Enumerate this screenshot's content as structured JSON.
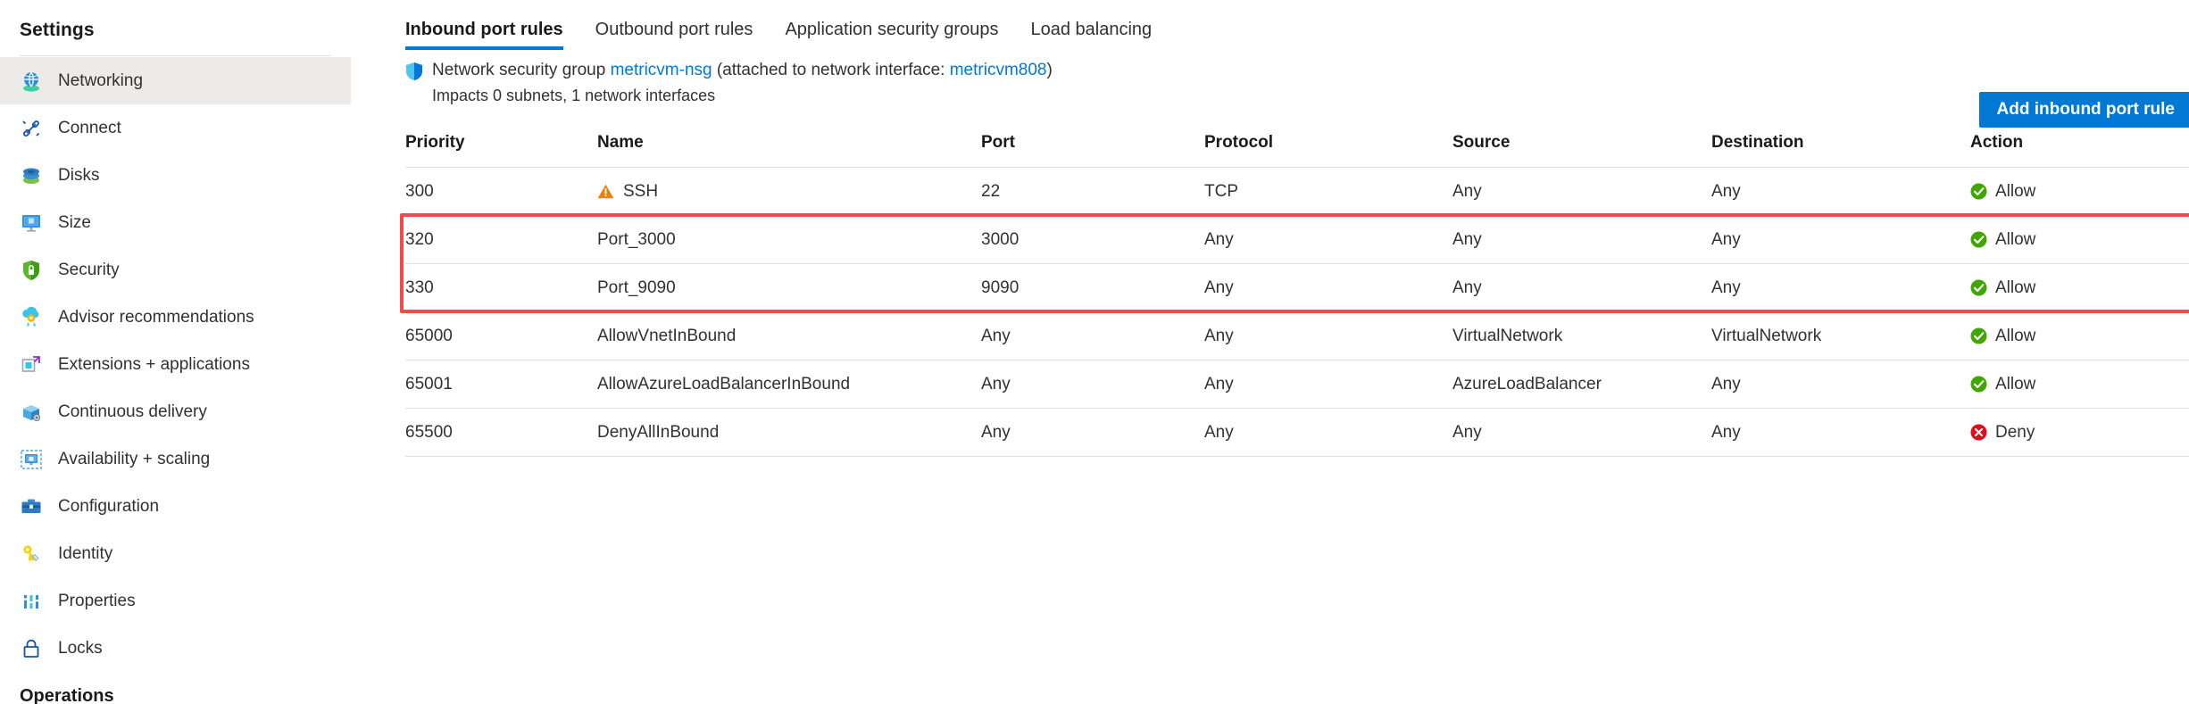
{
  "sidebar": {
    "title": "Settings",
    "group_title": "Operations",
    "items": [
      {
        "label": "Networking",
        "icon": "networking-icon",
        "selected": true
      },
      {
        "label": "Connect",
        "icon": "connect-icon",
        "selected": false
      },
      {
        "label": "Disks",
        "icon": "disks-icon",
        "selected": false
      },
      {
        "label": "Size",
        "icon": "size-icon",
        "selected": false
      },
      {
        "label": "Security",
        "icon": "security-shield-icon",
        "selected": false
      },
      {
        "label": "Advisor recommendations",
        "icon": "advisor-icon",
        "selected": false
      },
      {
        "label": "Extensions + applications",
        "icon": "extensions-icon",
        "selected": false
      },
      {
        "label": "Continuous delivery",
        "icon": "continuous-delivery-icon",
        "selected": false
      },
      {
        "label": "Availability + scaling",
        "icon": "availability-scaling-icon",
        "selected": false
      },
      {
        "label": "Configuration",
        "icon": "configuration-icon",
        "selected": false
      },
      {
        "label": "Identity",
        "icon": "identity-key-icon",
        "selected": false
      },
      {
        "label": "Properties",
        "icon": "properties-icon",
        "selected": false
      },
      {
        "label": "Locks",
        "icon": "lock-icon",
        "selected": false
      }
    ]
  },
  "tabs": [
    {
      "label": "Inbound port rules",
      "active": true
    },
    {
      "label": "Outbound port rules",
      "active": false
    },
    {
      "label": "Application security groups",
      "active": false
    },
    {
      "label": "Load balancing",
      "active": false
    }
  ],
  "nsg": {
    "prefix": "Network security group ",
    "name": "metricvm-nsg",
    "attach_prefix": " (attached to network interface: ",
    "interface": "metricvm808",
    "attach_suffix": ")",
    "impacts": "Impacts 0 subnets, 1 network interfaces",
    "icon": "shield-icon"
  },
  "toolbar": {
    "add_rule_label": "Add inbound port rule"
  },
  "table": {
    "columns": [
      "Priority",
      "Name",
      "Port",
      "Protocol",
      "Source",
      "Destination",
      "Action"
    ],
    "rows": [
      {
        "priority": "300",
        "name": "SSH",
        "name_icon": "warning-icon",
        "port": "22",
        "protocol": "TCP",
        "source": "Any",
        "destination": "Any",
        "action": "Allow",
        "action_icon": "allow-check-icon",
        "highlighted": false
      },
      {
        "priority": "320",
        "name": "Port_3000",
        "name_icon": null,
        "port": "3000",
        "protocol": "Any",
        "source": "Any",
        "destination": "Any",
        "action": "Allow",
        "action_icon": "allow-check-icon",
        "highlighted": true
      },
      {
        "priority": "330",
        "name": "Port_9090",
        "name_icon": null,
        "port": "9090",
        "protocol": "Any",
        "source": "Any",
        "destination": "Any",
        "action": "Allow",
        "action_icon": "allow-check-icon",
        "highlighted": true
      },
      {
        "priority": "65000",
        "name": "AllowVnetInBound",
        "name_icon": null,
        "port": "Any",
        "protocol": "Any",
        "source": "VirtualNetwork",
        "destination": "VirtualNetwork",
        "action": "Allow",
        "action_icon": "allow-check-icon",
        "highlighted": false
      },
      {
        "priority": "65001",
        "name": "AllowAzureLoadBalancerInBound",
        "name_icon": null,
        "port": "Any",
        "protocol": "Any",
        "source": "AzureLoadBalancer",
        "destination": "Any",
        "action": "Allow",
        "action_icon": "allow-check-icon",
        "highlighted": false
      },
      {
        "priority": "65500",
        "name": "DenyAllInBound",
        "name_icon": null,
        "port": "Any",
        "protocol": "Any",
        "source": "Any",
        "destination": "Any",
        "action": "Deny",
        "action_icon": "deny-cross-icon",
        "highlighted": false
      }
    ]
  },
  "colors": {
    "accent_blue": "#0078d4",
    "link_blue": "#0078d4",
    "allow_green": "#3fa700",
    "deny_red": "#e00b1c",
    "warning_orange": "#e8820c",
    "highlight_red": "#f04b4b",
    "selected_row_bg": "#edebe9"
  }
}
